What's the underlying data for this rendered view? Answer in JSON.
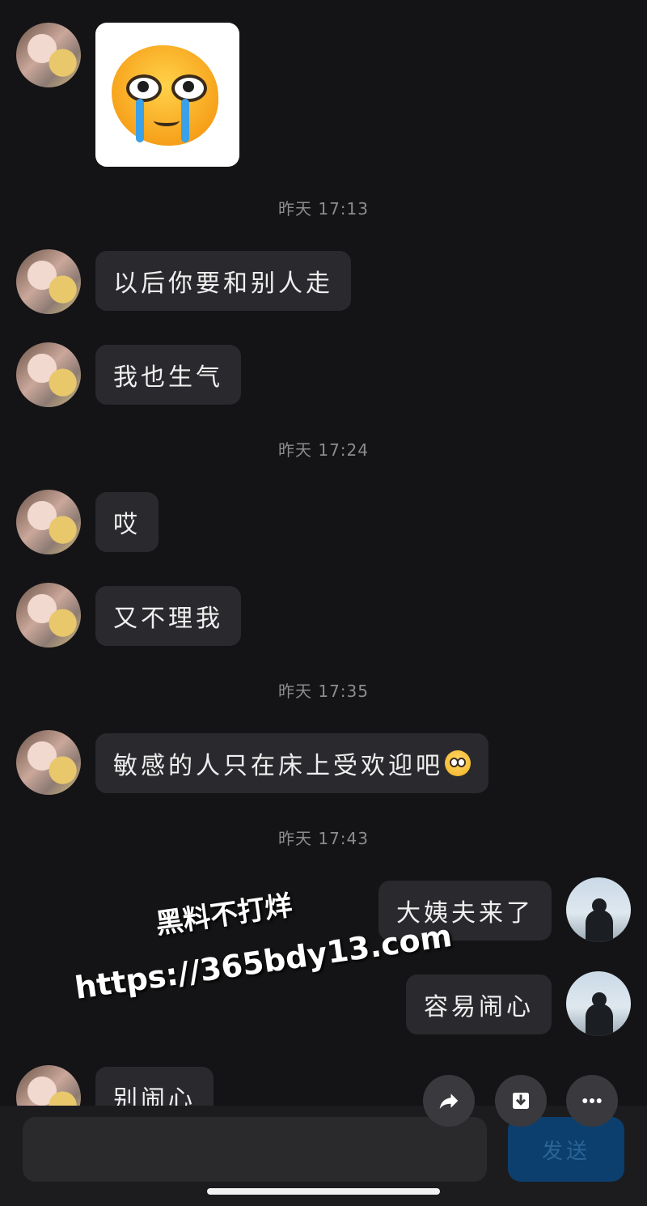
{
  "messages": [
    {
      "side": "left",
      "type": "sticker",
      "sticker": "crying-face-sticker"
    },
    {
      "type": "timestamp",
      "text": "昨天 17:13"
    },
    {
      "side": "left",
      "text": "以后你要和别人走"
    },
    {
      "side": "left",
      "text": "我也生气"
    },
    {
      "type": "timestamp",
      "text": "昨天 17:24"
    },
    {
      "side": "left",
      "text": "哎"
    },
    {
      "side": "left",
      "text": "又不理我"
    },
    {
      "type": "timestamp",
      "text": "昨天 17:35"
    },
    {
      "side": "left",
      "text": "敏感的人只在床上受欢迎吧",
      "emoji": "frowning-face-emoji"
    },
    {
      "type": "timestamp",
      "text": "昨天 17:43"
    },
    {
      "side": "right",
      "text": "大姨夫来了"
    },
    {
      "side": "right",
      "text": "容易闹心"
    },
    {
      "side": "left",
      "text": "别闹心"
    }
  ],
  "watermark": {
    "line1": "黑料不打烊",
    "line2": "https://365bdy13.com"
  },
  "actions": {
    "share_icon": "share-arrow-icon",
    "download_icon": "download-icon",
    "more_icon": "more-dots-icon"
  },
  "composer": {
    "send_label": "发送"
  },
  "colors": {
    "background": "#141416",
    "bubble": "#2a2a2e",
    "send_button": "#0c3f6e",
    "send_text": "#2a6496"
  }
}
